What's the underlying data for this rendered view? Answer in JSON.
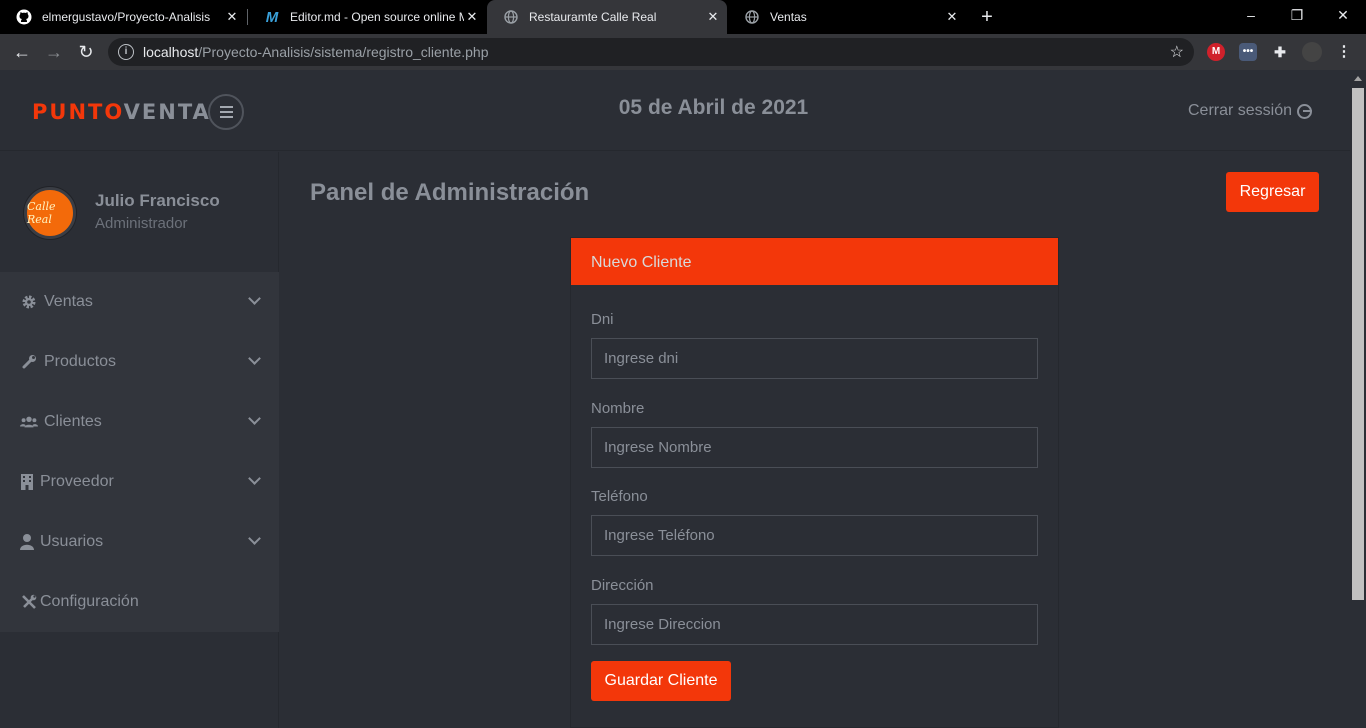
{
  "browser": {
    "tabs": [
      {
        "label": "elmergustavo/Proyecto-Analisis",
        "icon": "github-icon"
      },
      {
        "label": "Editor.md - Open source online M",
        "icon": "editor-md-icon"
      },
      {
        "label": "Restauramte Calle Real",
        "icon": "globe-icon",
        "active": true
      },
      {
        "label": "Ventas",
        "icon": "globe-icon"
      }
    ],
    "url_host": "localhost",
    "url_path": "/Proyecto-Analisis/sistema/registro_cliente.php"
  },
  "header": {
    "logo_part1": "PUNTO",
    "logo_part2": "VENTA",
    "date": "05 de Abril de 2021",
    "logout_label": "Cerrar sessión"
  },
  "profile": {
    "name": "Julio Francisco",
    "role": "Administrador",
    "avatar_text": "Calle Real"
  },
  "sidebar": {
    "items": [
      {
        "label": "Ventas",
        "icon": "gear-icon",
        "expandable": true
      },
      {
        "label": "Productos",
        "icon": "wrench-icon",
        "expandable": true
      },
      {
        "label": "Clientes",
        "icon": "users-icon",
        "expandable": true
      },
      {
        "label": "Proveedor",
        "icon": "building-icon",
        "expandable": true
      },
      {
        "label": "Usuarios",
        "icon": "user-icon",
        "expandable": true
      },
      {
        "label": "Configuración",
        "icon": "tools-icon",
        "expandable": false
      }
    ]
  },
  "main": {
    "title": "Panel de Administración",
    "back_button": "Regresar",
    "form": {
      "header": "Nuevo Cliente",
      "fields": [
        {
          "label": "Dni",
          "placeholder": "Ingrese dni"
        },
        {
          "label": "Nombre",
          "placeholder": "Ingrese Nombre"
        },
        {
          "label": "Teléfono",
          "placeholder": "Ingrese Teléfono"
        },
        {
          "label": "Dirección",
          "placeholder": "Ingrese Direccion"
        }
      ],
      "submit": "Guardar Cliente"
    }
  },
  "colors": {
    "accent": "#f3370a",
    "background": "#2b2e35",
    "menu_bg": "#32353c",
    "text_muted": "#8a8f98"
  }
}
